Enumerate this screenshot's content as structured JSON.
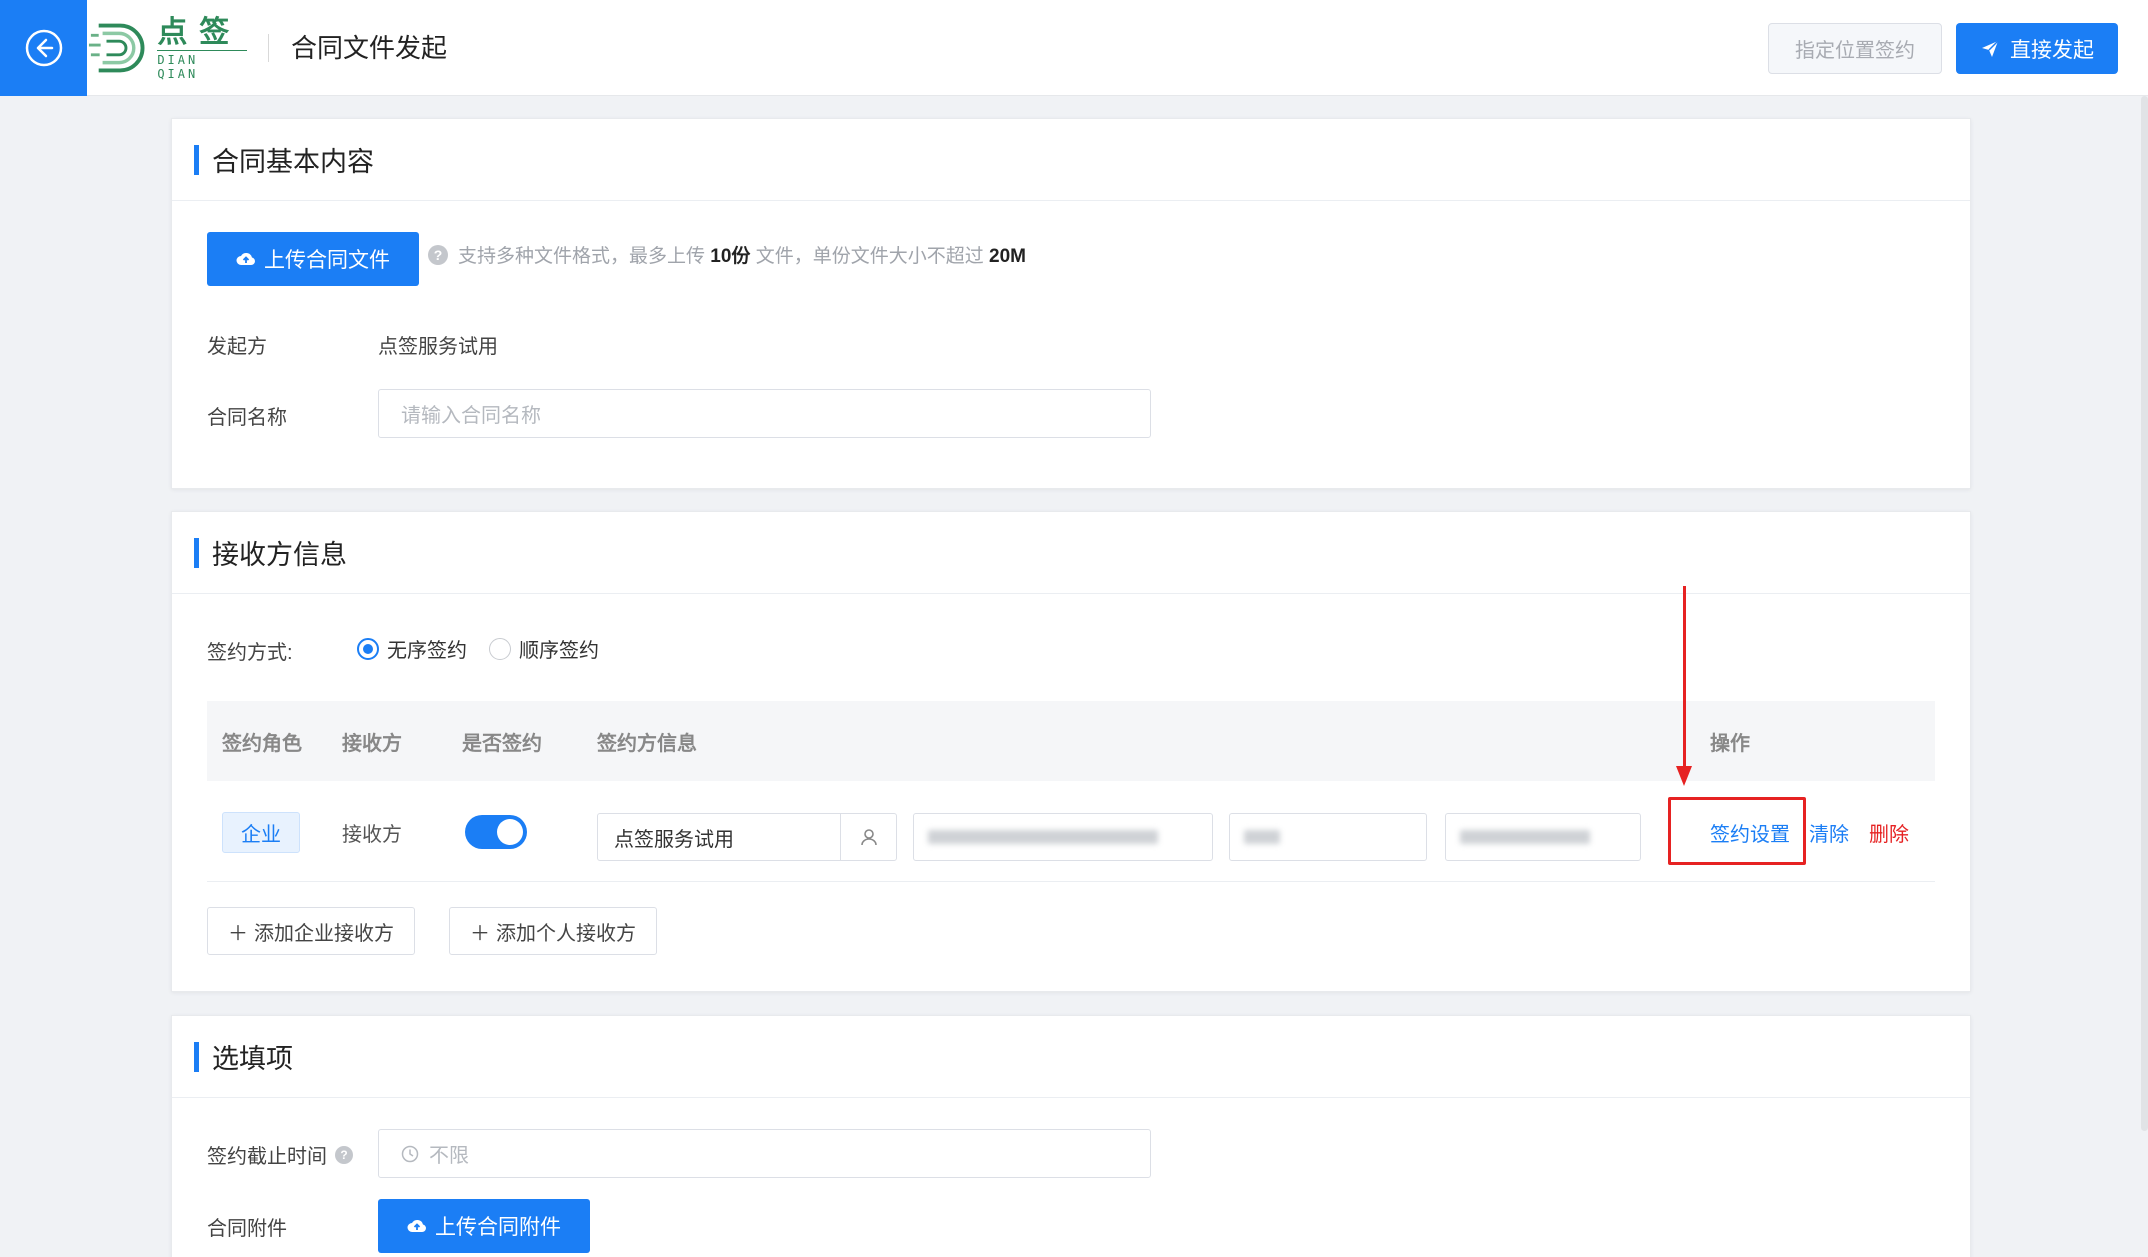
{
  "header": {
    "logo_cn": "点签",
    "logo_en": "DIAN QIAN",
    "title": "合同文件发起",
    "locate_sign_label": "指定位置签约",
    "direct_send_label": "直接发起"
  },
  "basic": {
    "section_title": "合同基本内容",
    "upload_label": "上传合同文件",
    "hint_prefix": "支持多种文件格式，最多上传",
    "hint_count": "10份",
    "hint_middle": "文件，单份文件大小不超过",
    "hint_size": "20M",
    "initiator_label": "发起方",
    "initiator_value": "点签服务试用",
    "contract_name_label": "合同名称",
    "contract_name_placeholder": "请输入合同名称"
  },
  "receivers": {
    "section_title": "接收方信息",
    "sign_mode_label": "签约方式:",
    "modes": [
      "无序签约",
      "顺序签约"
    ],
    "selected_mode": "无序签约",
    "columns": [
      "签约角色",
      "接收方",
      "是否签约",
      "签约方信息",
      "操作"
    ],
    "row": {
      "role": "企业",
      "receiver": "接收方",
      "signing_enabled": true,
      "signer_name": "点签服务试用"
    },
    "actions": [
      "签约设置",
      "清除",
      "删除"
    ],
    "add_company_label": "添加企业接收方",
    "add_person_label": "添加个人接收方"
  },
  "optional": {
    "section_title": "选填项",
    "deadline_label": "签约截止时间",
    "deadline_placeholder": "不限",
    "attachment_label": "合同附件",
    "upload_attachment_label": "上传合同附件"
  },
  "colors": {
    "primary": "#1b7ef5",
    "danger": "#e62222",
    "brand_green": "#2e8a5a"
  }
}
